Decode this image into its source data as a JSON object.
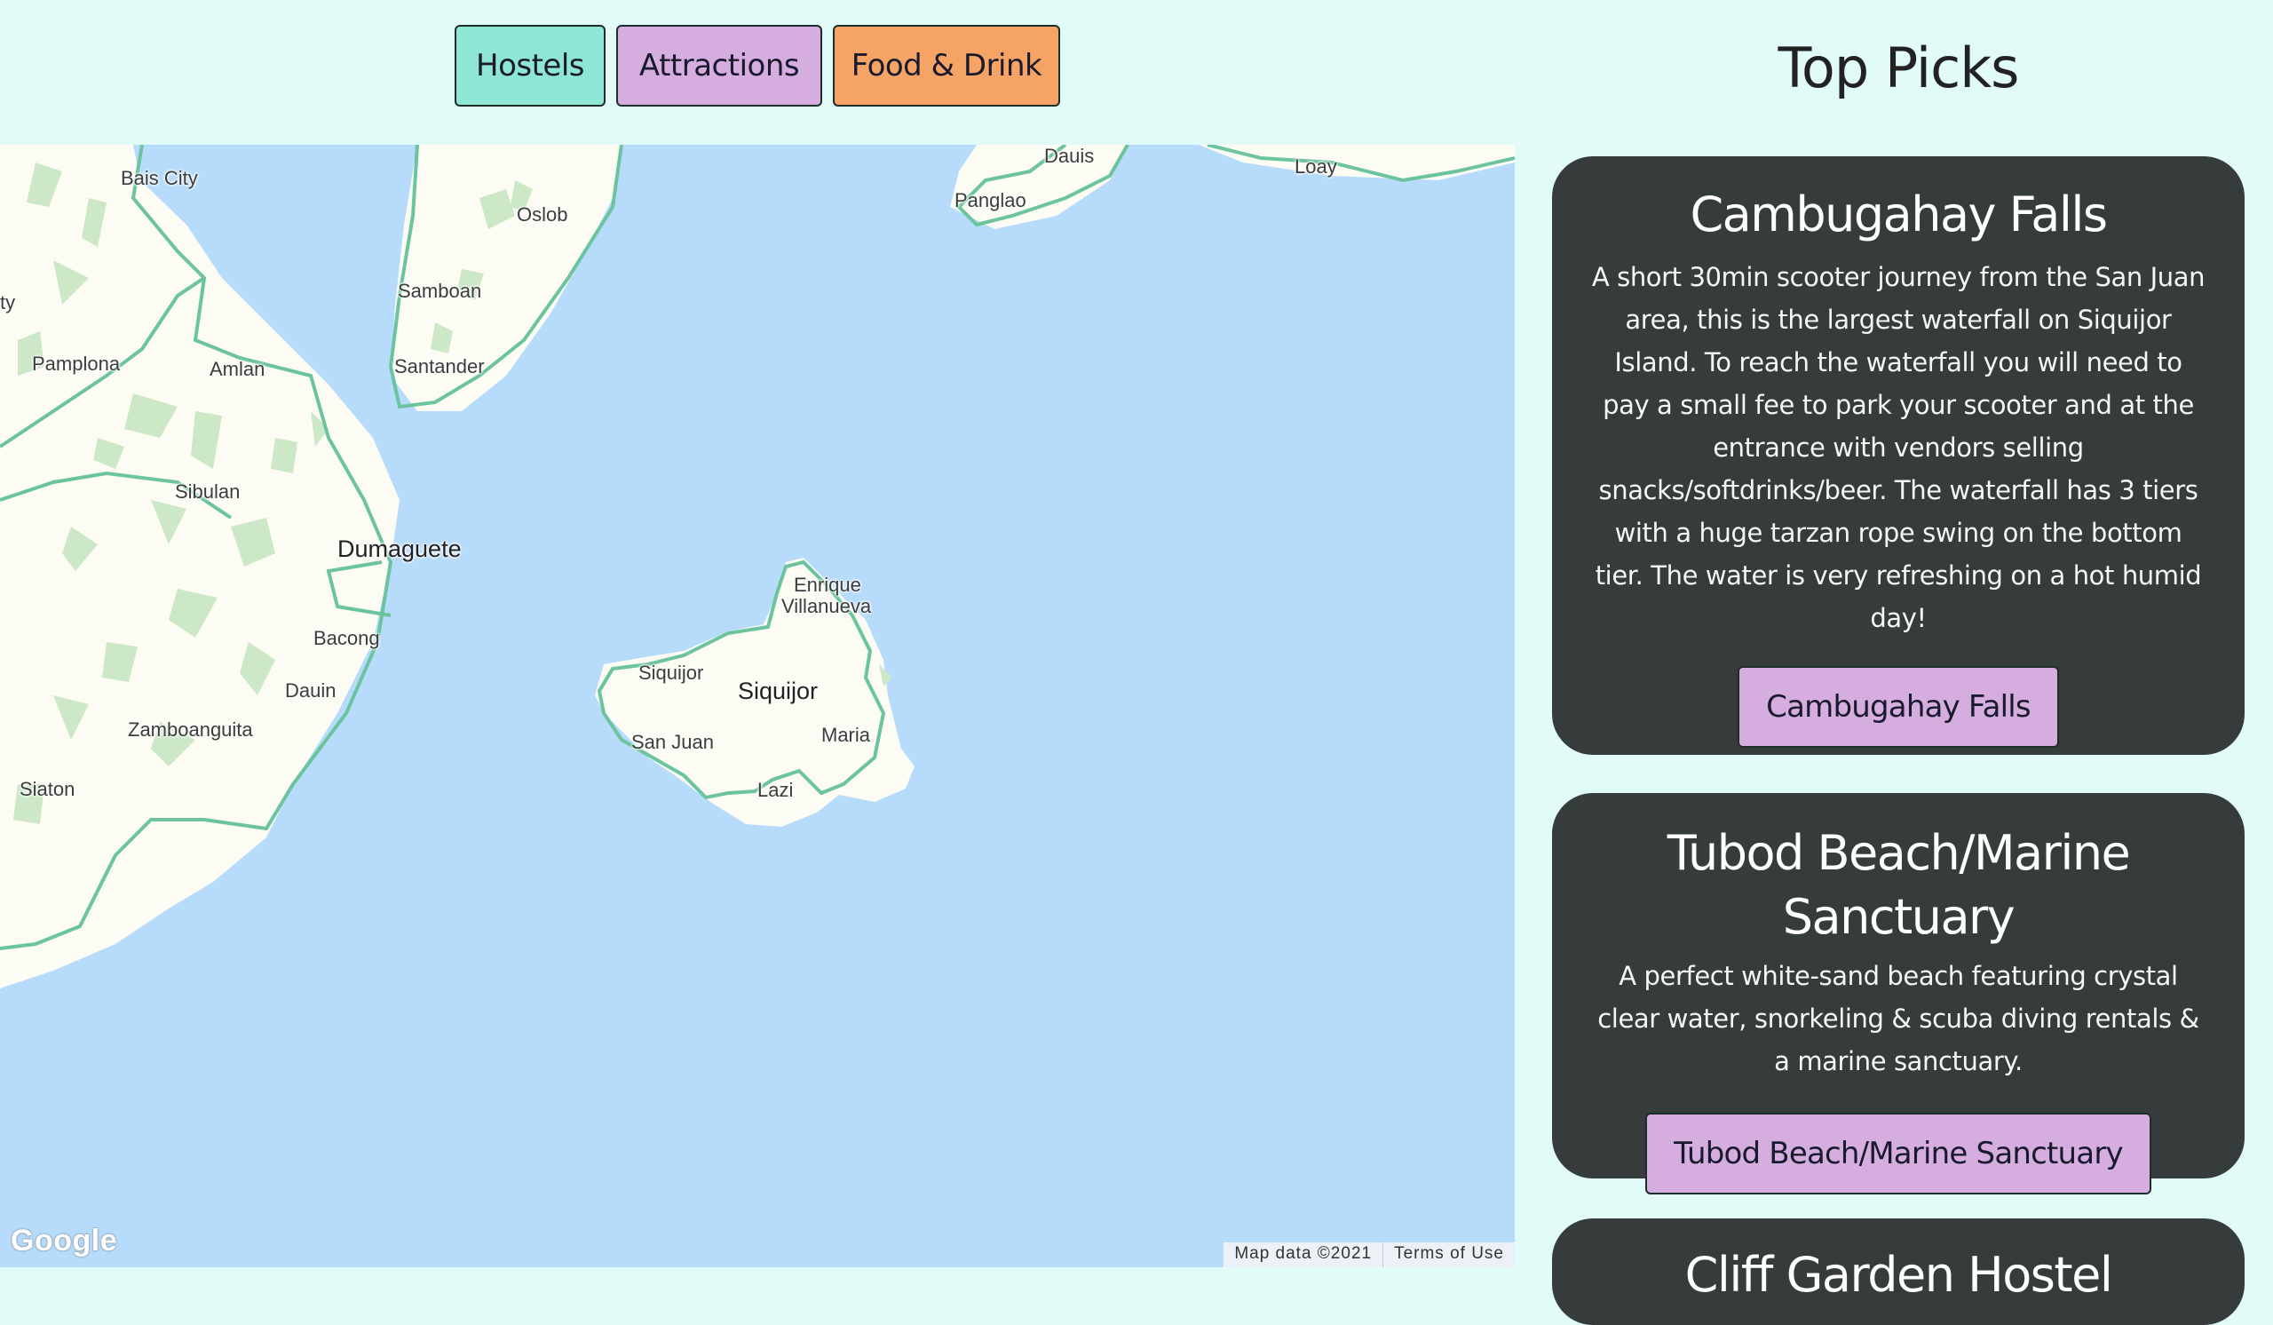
{
  "filters": {
    "hostels": "Hostels",
    "attractions": "Attractions",
    "food_drink": "Food & Drink"
  },
  "map": {
    "places": {
      "bais_city": "Bais City",
      "oslob": "Oslob",
      "dauis": "Dauis",
      "panglao": "Panglao",
      "loay": "Loay",
      "samboan": "Samboan",
      "santander": "Santander",
      "pamplona": "Pamplona",
      "amlan": "Amlan",
      "sibulan": "Sibulan",
      "dumaguete": "Dumaguete",
      "bacong": "Bacong",
      "dauin": "Dauin",
      "zamboanguita": "Zamboanguita",
      "siaton": "Siaton",
      "enrique": "Enrique",
      "villanueva": "Villanueva",
      "siquijor_town": "Siquijor",
      "siquijor_island": "Siquijor",
      "san_juan": "San Juan",
      "maria": "Maria",
      "lazi": "Lazi",
      "edge_label": "ty"
    },
    "logo": "Google",
    "attribution": "Map data ©2021",
    "terms": "Terms of Use",
    "colors": {
      "water": "#b6dbfb",
      "land": "#fcfcf4",
      "forest": "#cce8c6",
      "road": "#6cc49e"
    }
  },
  "sidebar": {
    "title": "Top Picks",
    "cards": [
      {
        "title": "Cambugahay Falls",
        "description": "A short 30min scooter journey from the San Juan area, this is the largest waterfall on Siquijor Island. To reach the waterfall you will need to pay a small fee to park your scooter and at the entrance with vendors selling snacks/softdrinks/beer. The waterfall has 3 tiers with a huge tarzan rope swing on the bottom tier. The water is very refreshing on a hot humid day!",
        "button": "Cambugahay Falls"
      },
      {
        "title": "Tubod Beach/Marine Sanctuary",
        "description": "A perfect white-sand beach featuring crystal clear water, snorkeling & scuba diving rentals & a marine sanctuary.",
        "button": "Tubod Beach/Marine Sanctuary"
      },
      {
        "title": "Cliff Garden Hostel"
      }
    ]
  },
  "colors": {
    "page_bg": "#e0fbf8",
    "card_bg": "#363c3c",
    "hostels_btn": "#8ee6d4",
    "attractions_btn": "#d5aedf",
    "food_btn": "#f5a466"
  }
}
